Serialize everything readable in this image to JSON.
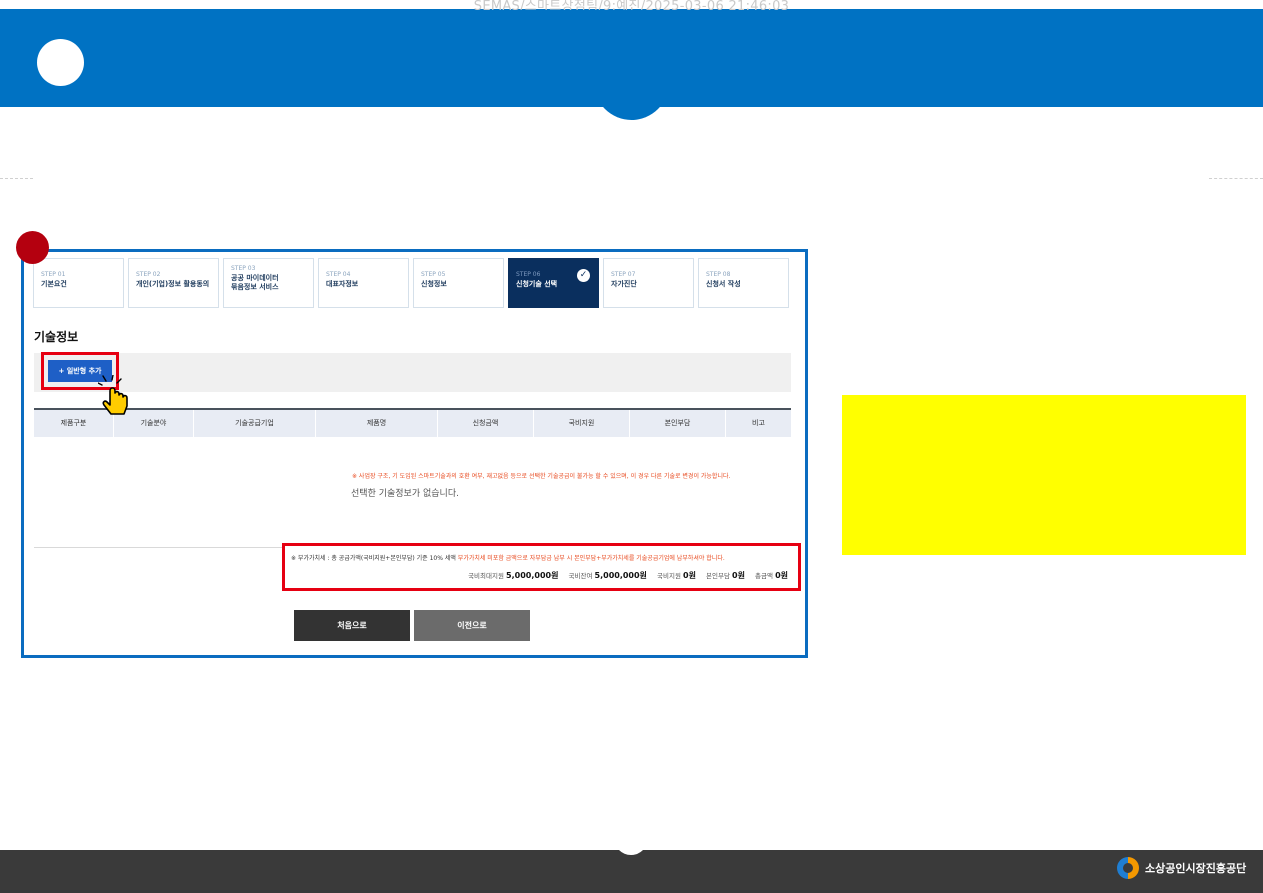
{
  "watermark": "SEMAS/스마트상점팀/9:예진/2025-03-06 21:46:03",
  "steps": [
    {
      "num": "STEP 01",
      "label": "기본요건"
    },
    {
      "num": "STEP 02",
      "label": "개인(기업)정보 활용동의"
    },
    {
      "num": "STEP 03",
      "label1": "공공 마이데이터",
      "label2": "묶음정보 서비스"
    },
    {
      "num": "STEP 04",
      "label": "대표자정보"
    },
    {
      "num": "STEP 05",
      "label": "신청정보"
    },
    {
      "num": "STEP 06",
      "label": "신청기술 선택",
      "active": true
    },
    {
      "num": "STEP 07",
      "label": "자가진단"
    },
    {
      "num": "STEP 08",
      "label": "신청서 작성"
    }
  ],
  "section_title": "기술정보",
  "add_button": "+ 일반형 추가",
  "notice": "※ 사업장 구조, 기 도입된 스마트기술과의 호환 여부, 재고없음 등으로 선택한 기술공급이 불가능 할 수 있으며, 이 경우 다른 기술로 변경이 가능합니다.",
  "table": {
    "columns": [
      "제품구분",
      "기술분야",
      "기술공급기업",
      "제품명",
      "신청금액",
      "국비지원",
      "본인부담",
      "비고"
    ],
    "empty_message": "선택한 기술정보가 없습니다."
  },
  "vat": {
    "prefix": "※ 부가가치세 : 총 공급가액(국비지원+본인부담) 기준 10% 세액 ",
    "red": "부가가치세 미포함 금액으로 자부담금 납부 시 본인부담+부가가치세를 기술공급기업에 납부하셔야 합니다."
  },
  "totals": [
    {
      "label": "국비최대지원",
      "value": "5,000,000원"
    },
    {
      "label": "국비잔여",
      "value": "5,000,000원"
    },
    {
      "label": "국비지원",
      "value": "0원"
    },
    {
      "label": "본인부담",
      "value": "0원"
    },
    {
      "label": "총금액",
      "value": "0원"
    }
  ],
  "buttons": {
    "home": "처음으로",
    "prev": "이전으로"
  },
  "footer": {
    "org_name": "소상공인시장진흥공단"
  },
  "colors": {
    "brand_blue": "#0072c3",
    "highlight_red": "#e60012",
    "active_step": "#0a2f5e",
    "note_yellow": "#ffff00"
  }
}
